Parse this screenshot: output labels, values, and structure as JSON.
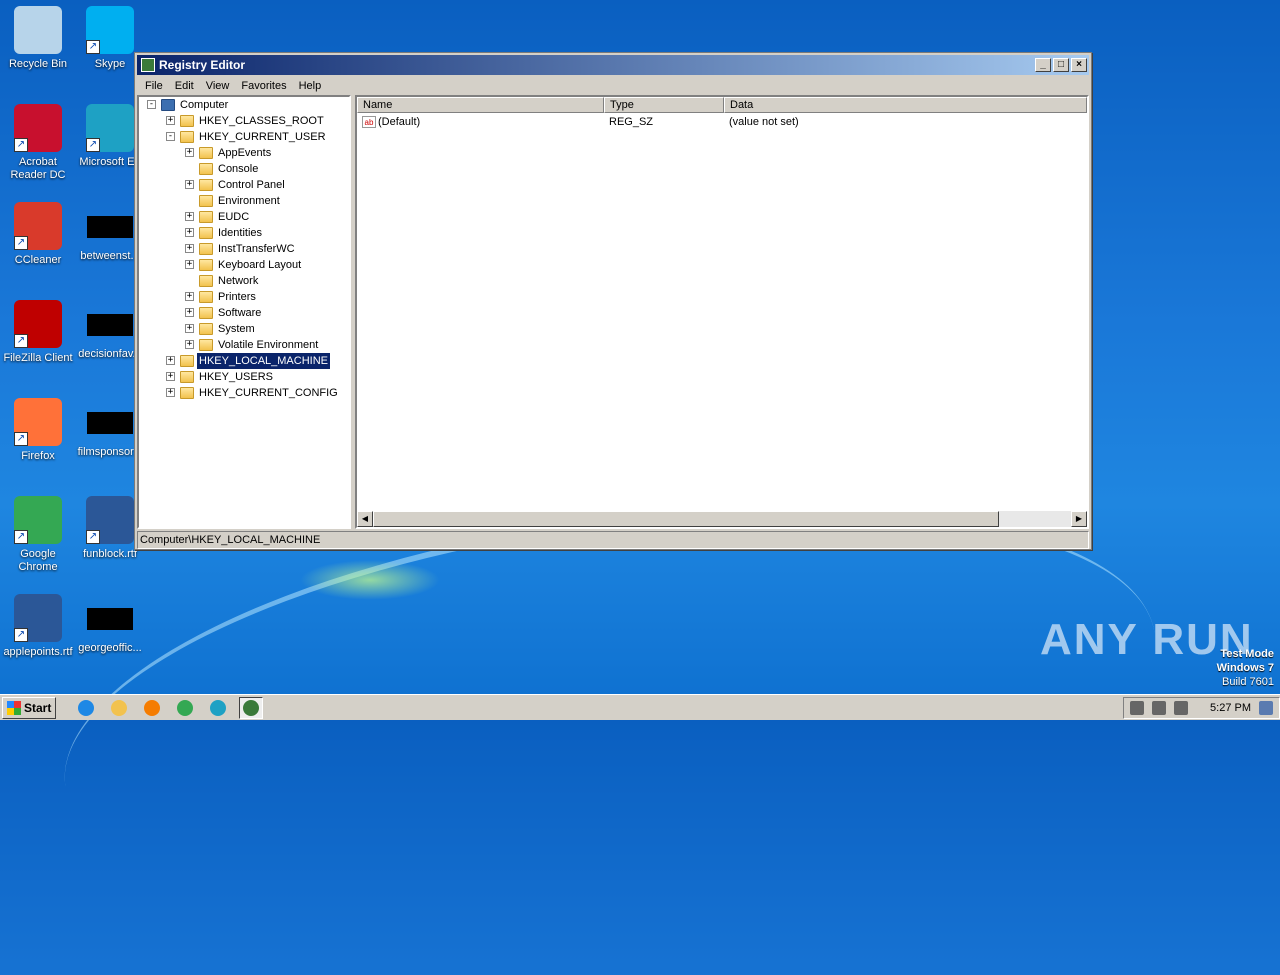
{
  "desktop": {
    "icons": [
      {
        "label": "Recycle Bin",
        "icon": "recycle-bin-icon",
        "color": "#b7d4ea"
      },
      {
        "label": "Skype",
        "icon": "skype-icon",
        "color": "#00aff0"
      },
      {
        "label": "Acrobat Reader DC",
        "icon": "acrobat-icon",
        "color": "#c8102e"
      },
      {
        "label": "Microsoft Ed",
        "icon": "edge-icon",
        "color": "#1ea1c4"
      },
      {
        "label": "CCleaner",
        "icon": "ccleaner-icon",
        "color": "#d93a2b"
      },
      {
        "label": "betweenst...",
        "icon": "redacted-file-icon",
        "color": "#000000"
      },
      {
        "label": "FileZilla Client",
        "icon": "filezilla-icon",
        "color": "#bf0000"
      },
      {
        "label": "decisionfav...",
        "icon": "redacted-file-icon",
        "color": "#000000"
      },
      {
        "label": "Firefox",
        "icon": "firefox-icon",
        "color": "#ff7139"
      },
      {
        "label": "filmsponsor...",
        "icon": "redacted-file-icon",
        "color": "#000000"
      },
      {
        "label": "Google Chrome",
        "icon": "chrome-icon",
        "color": "#34a853"
      },
      {
        "label": "funblock.rtf",
        "icon": "word-doc-icon",
        "color": "#2b5797"
      },
      {
        "label": "applepoints.rtf",
        "icon": "word-doc-icon",
        "color": "#2b5797"
      },
      {
        "label": "georgeoffic...",
        "icon": "redacted-file-icon",
        "color": "#000000"
      }
    ]
  },
  "window": {
    "title": "Registry Editor",
    "controls": {
      "minimize": "_",
      "maximize": "□",
      "close": "×"
    },
    "menu": [
      "File",
      "Edit",
      "View",
      "Favorites",
      "Help"
    ],
    "tree": [
      {
        "label": "Computer",
        "expander": "-",
        "level": 0
      },
      {
        "label": "HKEY_CLASSES_ROOT",
        "expander": "+",
        "level": 1
      },
      {
        "label": "HKEY_CURRENT_USER",
        "expander": "-",
        "level": 1
      },
      {
        "label": "AppEvents",
        "expander": "+",
        "level": 2
      },
      {
        "label": "Console",
        "expander": "",
        "level": 2
      },
      {
        "label": "Control Panel",
        "expander": "+",
        "level": 2
      },
      {
        "label": "Environment",
        "expander": "",
        "level": 2
      },
      {
        "label": "EUDC",
        "expander": "+",
        "level": 2
      },
      {
        "label": "Identities",
        "expander": "+",
        "level": 2
      },
      {
        "label": "InstTransferWC",
        "expander": "+",
        "level": 2
      },
      {
        "label": "Keyboard Layout",
        "expander": "+",
        "level": 2
      },
      {
        "label": "Network",
        "expander": "",
        "level": 2
      },
      {
        "label": "Printers",
        "expander": "+",
        "level": 2
      },
      {
        "label": "Software",
        "expander": "+",
        "level": 2
      },
      {
        "label": "System",
        "expander": "+",
        "level": 2
      },
      {
        "label": "Volatile Environment",
        "expander": "+",
        "level": 2
      },
      {
        "label": "HKEY_LOCAL_MACHINE",
        "expander": "+",
        "level": 1,
        "selected": true
      },
      {
        "label": "HKEY_USERS",
        "expander": "+",
        "level": 1
      },
      {
        "label": "HKEY_CURRENT_CONFIG",
        "expander": "+",
        "level": 1
      }
    ],
    "columns": [
      "Name",
      "Type",
      "Data"
    ],
    "rows": [
      {
        "icon": "ab",
        "name": "(Default)",
        "type": "REG_SZ",
        "data": "(value not set)"
      }
    ],
    "status": "Computer\\HKEY_LOCAL_MACHINE"
  },
  "watermark": {
    "text": "ANY RUN"
  },
  "testmode": {
    "line1": "Test Mode",
    "line2": "Windows 7",
    "line3": "Build 7601"
  },
  "taskbar": {
    "start_label": "Start",
    "quicklaunch": [
      {
        "icon": "ie-icon",
        "color": "#1e88e5"
      },
      {
        "icon": "explorer-icon",
        "color": "#f2c24e"
      },
      {
        "icon": "media-player-icon",
        "color": "#f57c00"
      },
      {
        "icon": "chrome-icon",
        "color": "#34a853"
      },
      {
        "icon": "edge-icon",
        "color": "#1ea1c4"
      },
      {
        "icon": "regedit-icon",
        "color": "#3a7a3a",
        "active": true
      }
    ],
    "clock": "5:27 PM"
  }
}
